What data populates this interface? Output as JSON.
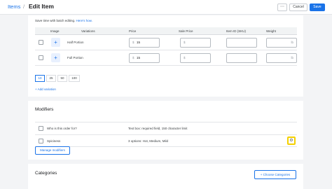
{
  "header": {
    "breadcrumb": "Items",
    "separator": "/",
    "title": "Edit Item",
    "more_label": "⋯",
    "cancel_label": "Cancel",
    "save_label": "Save"
  },
  "variations": {
    "hint_text": "Save time with batch editing.",
    "hint_link": "Here's how.",
    "columns": [
      "Image",
      "Variations",
      "Price",
      "Sale Price",
      "Item ID (SKU)",
      "Weight"
    ],
    "rows": [
      {
        "name": "Half Portion",
        "price": "15",
        "sale_price": "",
        "sku": "",
        "weight": ""
      },
      {
        "name": "Full Portion",
        "price": "15",
        "sale_price": "",
        "sku": "",
        "weight": ""
      }
    ],
    "currency_symbol": "$",
    "weight_unit": "lb",
    "page_sizes": [
      "10",
      "25",
      "50",
      "100"
    ],
    "selected_page_size": "10",
    "add_label": "+ Add variation"
  },
  "modifiers": {
    "title": "Modifiers",
    "rows": [
      {
        "name": "Who is this order for?",
        "description": "Text box: required field, 150 character limit"
      },
      {
        "name": "Spiciness",
        "description": "3 options: Hot, Medium, Mild"
      }
    ],
    "manage_label": "Manage modifiers"
  },
  "categories": {
    "title": "Categories",
    "choose_label": "+ Choose Categories"
  },
  "colors": {
    "accent": "#1a73e8",
    "highlight": "#f4d000"
  }
}
